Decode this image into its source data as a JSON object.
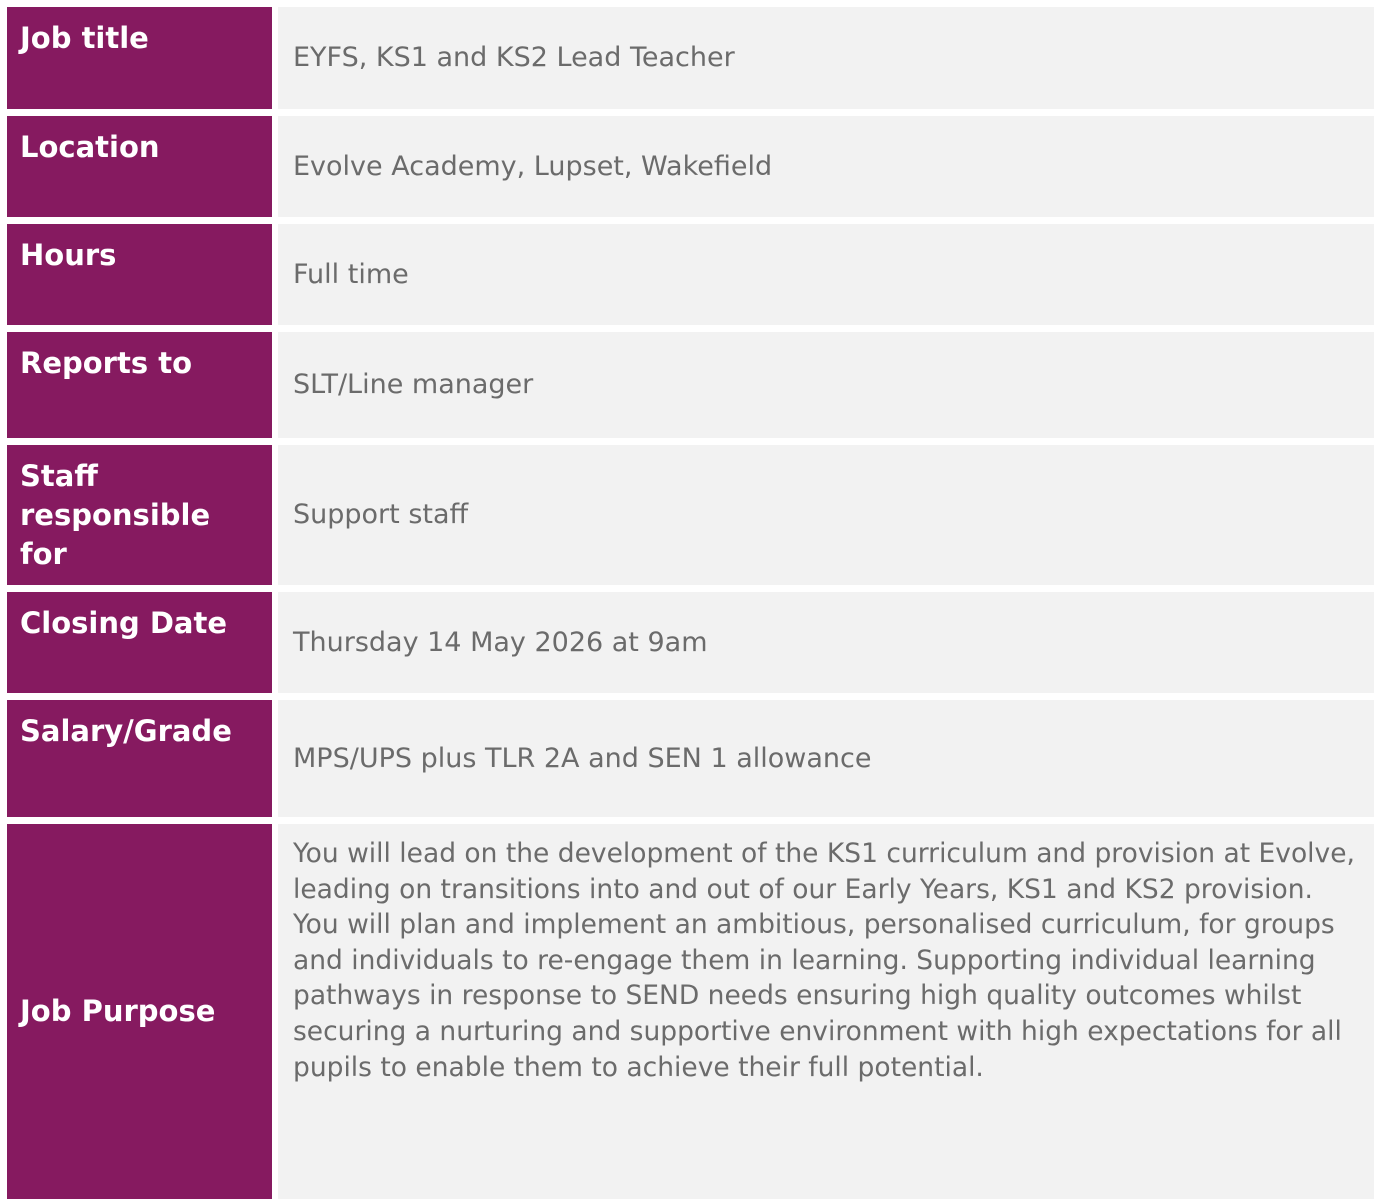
{
  "rows": [
    {
      "label": "Job title",
      "value": "EYFS, KS1 and KS2 Lead Teacher"
    },
    {
      "label": "Location",
      "value": "Evolve Academy, Lupset, Wakefield"
    },
    {
      "label": "Hours",
      "value": "Full time"
    },
    {
      "label": "Reports to",
      "value": "SLT/Line manager"
    },
    {
      "label": "Staff responsible for",
      "value": "Support staff"
    },
    {
      "label": "Closing Date",
      "value": "Thursday 14 May 2026 at 9am"
    },
    {
      "label": "Salary/Grade",
      "value": "MPS/UPS plus TLR 2A and SEN 1 allowance"
    },
    {
      "label": "Job Purpose",
      "value": "You will lead on the development of the KS1 curriculum and provision at Evolve, leading on transitions into and out of our Early Years, KS1 and KS2 provision. You will plan and implement an ambitious, personalised curriculum, for groups and individuals to re-engage them in learning. Supporting individual learning pathways in response to SEND needs ensuring high quality outcomes whilst securing a nurturing and supportive environment with high expectations for all pupils to enable them to achieve their full potential."
    }
  ],
  "colors": {
    "label_background": "#861a60",
    "label_text": "#ffffff",
    "value_background": "#f2f2f2",
    "value_text": "#6b6b6b"
  }
}
